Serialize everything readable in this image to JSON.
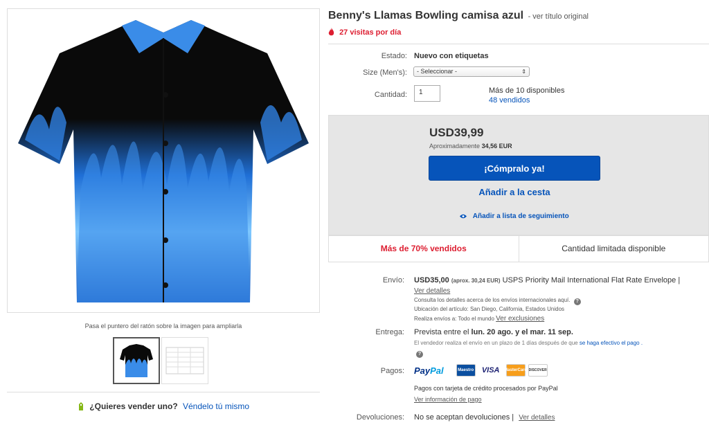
{
  "listing": {
    "title": "Benny's Llamas Bowling camisa azul",
    "original_title_link": "- ver título original",
    "views": "27 visitas por día"
  },
  "gallery": {
    "zoom_hint": "Pasa el puntero del ratón sobre la imagen para ampliarla",
    "sell_question": "¿Quieres vender uno?",
    "sell_link": "Véndelo tú mismo"
  },
  "details": {
    "condition_label": "Estado:",
    "condition_value": "Nuevo con etiquetas",
    "size_label": "Size (Men's):",
    "size_value": "- Seleccionar -",
    "qty_label": "Cantidad:",
    "qty_value": "1",
    "available": "Más de 10 disponibles",
    "sold": "48 vendidos"
  },
  "buybox": {
    "price": "USD39,99",
    "approx_prefix": "Aproximadamente",
    "approx_value": "34,56 EUR",
    "buy_now": "¡Cómpralo ya!",
    "add_to_cart": "Añadir a la cesta",
    "watch": "Añadir a lista de seguimiento",
    "signal_sold": "Más de 70% vendidos",
    "signal_limited": "Cantidad limitada disponible"
  },
  "shipping": {
    "label": "Envío:",
    "cost": "USD35,00",
    "approx": "(aprox. 30,24 EUR)",
    "service": "USPS Priority Mail International Flat Rate Envelope",
    "details_link": "Ver detalles",
    "intl_note": "Consulta los detalles acerca de los envíos internacionales aquí.",
    "location_label": "Ubicación del artículo:",
    "location": "San Diego, California, Estados Unidos",
    "ships_to_label": "Realiza envíos a:",
    "ships_to": "Todo el mundo",
    "exclusions_link": "Ver exclusiones"
  },
  "delivery": {
    "label": "Entrega:",
    "prefix": "Prevista entre el",
    "dates": "lun. 20 ago. y el mar. 11 sep.",
    "note": "El vendedor realiza el envío en un plazo de 1 días después de que",
    "note_link": "se haga efectivo el pago ."
  },
  "payments": {
    "label": "Pagos:",
    "paypal_a": "Pay",
    "paypal_b": "Pal",
    "card_maestro": "Maestro",
    "card_visa": "VISA",
    "card_mc": "MasterCard",
    "card_discover": "DISCOVER",
    "note": "Pagos con tarjeta de crédito procesados por PayPal",
    "info_link": "Ver información de pago"
  },
  "returns": {
    "label": "Devoluciones:",
    "value": "No se aceptan devoluciones",
    "details_link": "Ver detalles"
  },
  "colors": {
    "accent_blue": "#0654ba",
    "alert_red": "#dd1e31"
  }
}
